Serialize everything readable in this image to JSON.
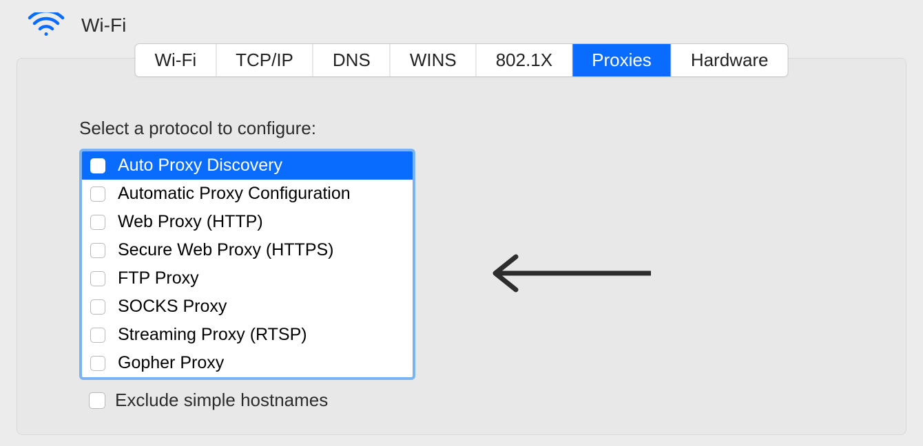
{
  "header": {
    "title": "Wi-Fi"
  },
  "tabs": {
    "items": [
      {
        "label": "Wi-Fi",
        "active": false
      },
      {
        "label": "TCP/IP",
        "active": false
      },
      {
        "label": "DNS",
        "active": false
      },
      {
        "label": "WINS",
        "active": false
      },
      {
        "label": "802.1X",
        "active": false
      },
      {
        "label": "Proxies",
        "active": true
      },
      {
        "label": "Hardware",
        "active": false
      }
    ]
  },
  "section": {
    "label": "Select a protocol to configure:"
  },
  "protocols": [
    {
      "label": "Auto Proxy Discovery",
      "checked": false,
      "selected": true
    },
    {
      "label": "Automatic Proxy Configuration",
      "checked": false,
      "selected": false
    },
    {
      "label": "Web Proxy (HTTP)",
      "checked": false,
      "selected": false
    },
    {
      "label": "Secure Web Proxy (HTTPS)",
      "checked": false,
      "selected": false
    },
    {
      "label": "FTP Proxy",
      "checked": false,
      "selected": false
    },
    {
      "label": "SOCKS Proxy",
      "checked": false,
      "selected": false
    },
    {
      "label": "Streaming Proxy (RTSP)",
      "checked": false,
      "selected": false
    },
    {
      "label": "Gopher Proxy",
      "checked": false,
      "selected": false
    }
  ],
  "exclude": {
    "label": "Exclude simple hostnames",
    "checked": false
  }
}
